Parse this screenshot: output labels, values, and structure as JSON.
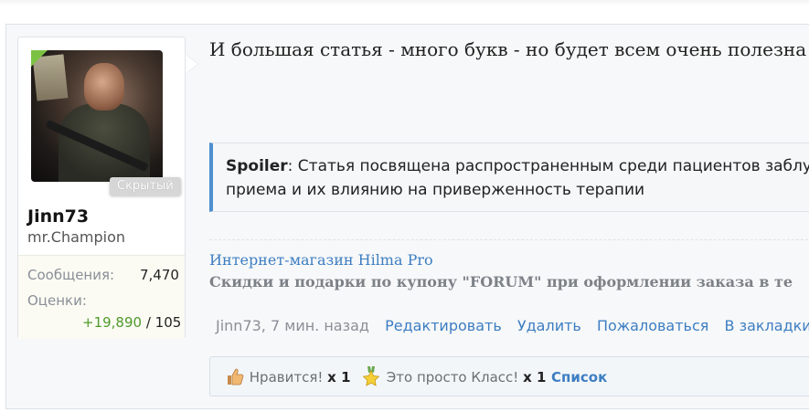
{
  "post": {
    "title": "И большая статья - много букв - но будет всем очень полезна",
    "spoiler": {
      "label": "Spoiler",
      "text_line1": ": Статья посвящена распространенным среди пациентов заблужд",
      "text_line2": "приема и их влиянию на приверженность терапии"
    },
    "signature": {
      "link": "Интернет-магазин Hilma Pro",
      "promo": "Скидки и подарки по купону \"FORUM\" при оформлении заказа в те"
    },
    "meta": {
      "author_time": "Jinn73, 7 мин. назад",
      "actions": [
        "Редактировать",
        "Удалить",
        "Пожаловаться",
        "В закладки"
      ]
    },
    "reactions": {
      "like_label": "Нравится!",
      "like_count": "x 1",
      "class_label": "Это просто Класс!",
      "class_count": "x 1",
      "list_link": "Список"
    }
  },
  "user": {
    "hidden_badge": "Скрытый",
    "name": "Jinn73",
    "title": "mr.Champion",
    "messages_label": "Сообщения:",
    "messages_value": "7,470",
    "ratings_label": "Оценки:",
    "ratings_positive": "+19,890",
    "ratings_rest": " / 105"
  },
  "colors": {
    "link": "#3d7ec2",
    "spoiler_border": "#4d8fcf",
    "positive": "#4f9a2a",
    "online_corner": "#7cc242"
  }
}
